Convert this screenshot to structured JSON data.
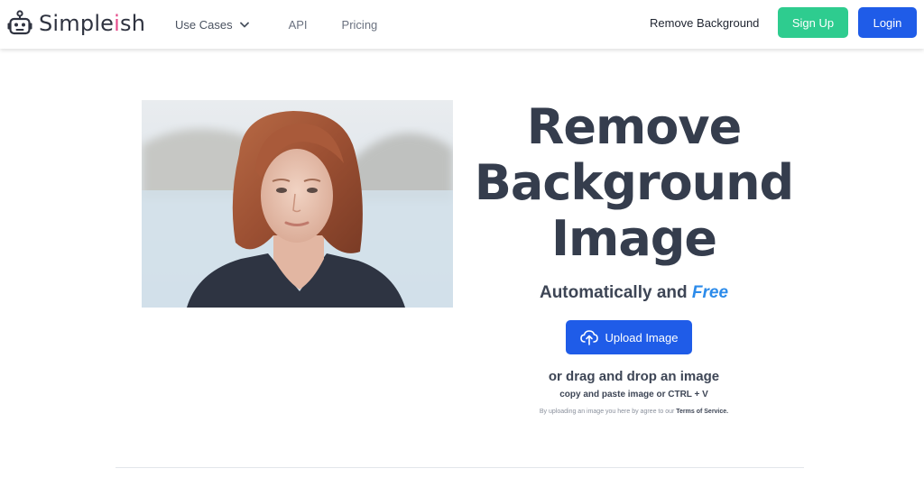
{
  "header": {
    "logo_prefix": "Simple",
    "logo_accent": "i",
    "logo_suffix": "sh",
    "nav": {
      "use_cases": "Use Cases",
      "api": "API",
      "pricing": "Pricing"
    },
    "remove_background": "Remove Background",
    "sign_up": "Sign Up",
    "login": "Login"
  },
  "hero": {
    "title_lines": [
      "Remove",
      "Background",
      "Image"
    ],
    "subtitle_prefix": "Automatically and ",
    "subtitle_accent": "Free",
    "upload_label": "Upload Image",
    "drag_text": "or drag and drop an image",
    "paste_text": "copy and paste image or CTRL + V",
    "tos_prefix": "By uploading an image you here by agree to our ",
    "tos_link": "Terms of Service."
  },
  "icons": {
    "logo": "robot-icon",
    "dropdown": "chevron-down-icon",
    "upload": "cloud-upload-icon"
  },
  "colors": {
    "accent_green": "#2ecc8f",
    "accent_blue": "#1f5ce8",
    "free_blue": "#2c8bea",
    "logo_pink": "#e54a8a",
    "title_text": "#353d4d"
  }
}
